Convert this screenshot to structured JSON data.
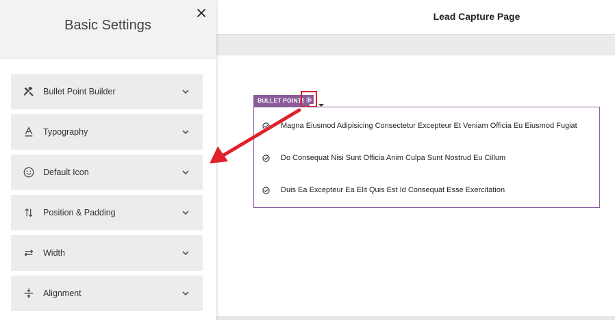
{
  "panel": {
    "title": "Basic Settings",
    "sections": [
      {
        "label": "Bullet Point Builder",
        "icon": "tools-icon"
      },
      {
        "label": "Typography",
        "icon": "typography-icon"
      },
      {
        "label": "Default Icon",
        "icon": "smiley-icon"
      },
      {
        "label": "Position & Padding",
        "icon": "vertical-arrows-icon"
      },
      {
        "label": "Width",
        "icon": "horizontal-arrows-icon"
      },
      {
        "label": "Alignment",
        "icon": "alignment-icon"
      }
    ]
  },
  "page": {
    "title": "Lead Capture Page"
  },
  "element": {
    "tag_label": "BULLET POINTS",
    "items": [
      "Magna Eiusmod Adipisicing Consectetur Excepteur Et Veniam Officia Eu Eiusmod Fugiat",
      "Do Consequat Nisi Sunt Officia Anim Culpa Sunt Nostrud Eu Cillum",
      "Duis Ea Excepteur Ea Elit Quis Est Id Consequat Esse Exercitation"
    ]
  },
  "colors": {
    "accent": "#8a5c9a",
    "highlight": "#e0202a"
  }
}
